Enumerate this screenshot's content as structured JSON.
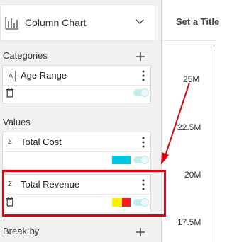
{
  "chart_type": {
    "label": "Column Chart",
    "icon": "column-chart-icon"
  },
  "sections": {
    "categories": {
      "title": "Categories"
    },
    "values": {
      "title": "Values"
    },
    "break_by": {
      "title": "Break by"
    }
  },
  "fields": {
    "age_range": {
      "label": "Age Range",
      "type_icon": "A"
    },
    "total_cost": {
      "label": "Total Cost",
      "type_icon": "Σ",
      "color": "#00c5e0"
    },
    "total_revenue": {
      "label": "Total Revenue",
      "type_icon": "Σ",
      "colors": [
        "#ffee00",
        "#ff1a1a"
      ]
    }
  },
  "right_panel": {
    "title": "Set a Title"
  },
  "axis": {
    "ticks": [
      "25M",
      "22.5M",
      "20M",
      "17.5M"
    ]
  },
  "colors": {
    "accent": "#00c5e0",
    "highlight": "#e0000f",
    "toggle": "#c4ecef"
  }
}
